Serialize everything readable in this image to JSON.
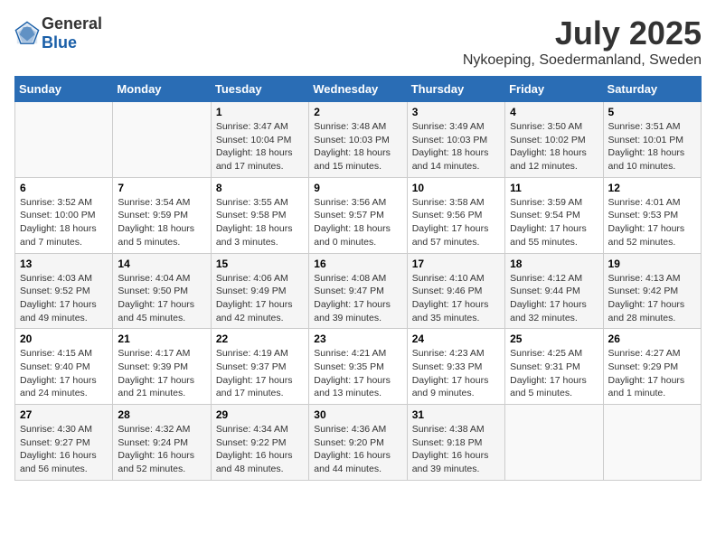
{
  "header": {
    "logo_general": "General",
    "logo_blue": "Blue",
    "month_title": "July 2025",
    "location": "Nykoeping, Soedermanland, Sweden"
  },
  "weekdays": [
    "Sunday",
    "Monday",
    "Tuesday",
    "Wednesday",
    "Thursday",
    "Friday",
    "Saturday"
  ],
  "weeks": [
    [
      {
        "day": "",
        "info": ""
      },
      {
        "day": "",
        "info": ""
      },
      {
        "day": "1",
        "info": "Sunrise: 3:47 AM\nSunset: 10:04 PM\nDaylight: 18 hours and 17 minutes."
      },
      {
        "day": "2",
        "info": "Sunrise: 3:48 AM\nSunset: 10:03 PM\nDaylight: 18 hours and 15 minutes."
      },
      {
        "day": "3",
        "info": "Sunrise: 3:49 AM\nSunset: 10:03 PM\nDaylight: 18 hours and 14 minutes."
      },
      {
        "day": "4",
        "info": "Sunrise: 3:50 AM\nSunset: 10:02 PM\nDaylight: 18 hours and 12 minutes."
      },
      {
        "day": "5",
        "info": "Sunrise: 3:51 AM\nSunset: 10:01 PM\nDaylight: 18 hours and 10 minutes."
      }
    ],
    [
      {
        "day": "6",
        "info": "Sunrise: 3:52 AM\nSunset: 10:00 PM\nDaylight: 18 hours and 7 minutes."
      },
      {
        "day": "7",
        "info": "Sunrise: 3:54 AM\nSunset: 9:59 PM\nDaylight: 18 hours and 5 minutes."
      },
      {
        "day": "8",
        "info": "Sunrise: 3:55 AM\nSunset: 9:58 PM\nDaylight: 18 hours and 3 minutes."
      },
      {
        "day": "9",
        "info": "Sunrise: 3:56 AM\nSunset: 9:57 PM\nDaylight: 18 hours and 0 minutes."
      },
      {
        "day": "10",
        "info": "Sunrise: 3:58 AM\nSunset: 9:56 PM\nDaylight: 17 hours and 57 minutes."
      },
      {
        "day": "11",
        "info": "Sunrise: 3:59 AM\nSunset: 9:54 PM\nDaylight: 17 hours and 55 minutes."
      },
      {
        "day": "12",
        "info": "Sunrise: 4:01 AM\nSunset: 9:53 PM\nDaylight: 17 hours and 52 minutes."
      }
    ],
    [
      {
        "day": "13",
        "info": "Sunrise: 4:03 AM\nSunset: 9:52 PM\nDaylight: 17 hours and 49 minutes."
      },
      {
        "day": "14",
        "info": "Sunrise: 4:04 AM\nSunset: 9:50 PM\nDaylight: 17 hours and 45 minutes."
      },
      {
        "day": "15",
        "info": "Sunrise: 4:06 AM\nSunset: 9:49 PM\nDaylight: 17 hours and 42 minutes."
      },
      {
        "day": "16",
        "info": "Sunrise: 4:08 AM\nSunset: 9:47 PM\nDaylight: 17 hours and 39 minutes."
      },
      {
        "day": "17",
        "info": "Sunrise: 4:10 AM\nSunset: 9:46 PM\nDaylight: 17 hours and 35 minutes."
      },
      {
        "day": "18",
        "info": "Sunrise: 4:12 AM\nSunset: 9:44 PM\nDaylight: 17 hours and 32 minutes."
      },
      {
        "day": "19",
        "info": "Sunrise: 4:13 AM\nSunset: 9:42 PM\nDaylight: 17 hours and 28 minutes."
      }
    ],
    [
      {
        "day": "20",
        "info": "Sunrise: 4:15 AM\nSunset: 9:40 PM\nDaylight: 17 hours and 24 minutes."
      },
      {
        "day": "21",
        "info": "Sunrise: 4:17 AM\nSunset: 9:39 PM\nDaylight: 17 hours and 21 minutes."
      },
      {
        "day": "22",
        "info": "Sunrise: 4:19 AM\nSunset: 9:37 PM\nDaylight: 17 hours and 17 minutes."
      },
      {
        "day": "23",
        "info": "Sunrise: 4:21 AM\nSunset: 9:35 PM\nDaylight: 17 hours and 13 minutes."
      },
      {
        "day": "24",
        "info": "Sunrise: 4:23 AM\nSunset: 9:33 PM\nDaylight: 17 hours and 9 minutes."
      },
      {
        "day": "25",
        "info": "Sunrise: 4:25 AM\nSunset: 9:31 PM\nDaylight: 17 hours and 5 minutes."
      },
      {
        "day": "26",
        "info": "Sunrise: 4:27 AM\nSunset: 9:29 PM\nDaylight: 17 hours and 1 minute."
      }
    ],
    [
      {
        "day": "27",
        "info": "Sunrise: 4:30 AM\nSunset: 9:27 PM\nDaylight: 16 hours and 56 minutes."
      },
      {
        "day": "28",
        "info": "Sunrise: 4:32 AM\nSunset: 9:24 PM\nDaylight: 16 hours and 52 minutes."
      },
      {
        "day": "29",
        "info": "Sunrise: 4:34 AM\nSunset: 9:22 PM\nDaylight: 16 hours and 48 minutes."
      },
      {
        "day": "30",
        "info": "Sunrise: 4:36 AM\nSunset: 9:20 PM\nDaylight: 16 hours and 44 minutes."
      },
      {
        "day": "31",
        "info": "Sunrise: 4:38 AM\nSunset: 9:18 PM\nDaylight: 16 hours and 39 minutes."
      },
      {
        "day": "",
        "info": ""
      },
      {
        "day": "",
        "info": ""
      }
    ]
  ]
}
